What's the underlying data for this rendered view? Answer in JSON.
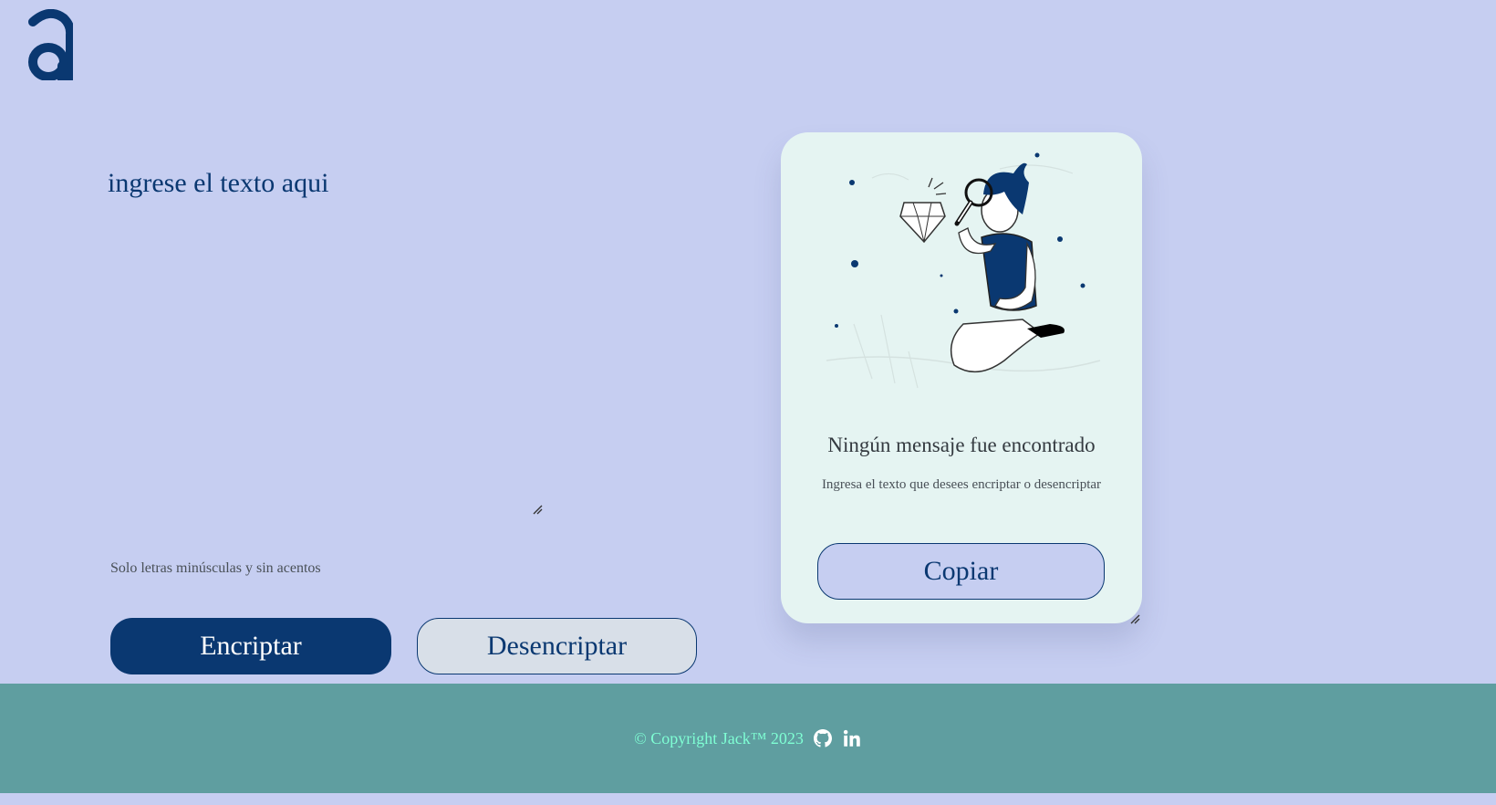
{
  "logo": {
    "text": "a"
  },
  "input": {
    "placeholder": "ingrese el texto aqui",
    "value": ""
  },
  "hint": {
    "icon": "info-icon",
    "text": "Solo letras minúsculas y sin acentos"
  },
  "buttons": {
    "encrypt_label": "Encriptar",
    "decrypt_label": "Desencriptar"
  },
  "output_card": {
    "illustration": "person-with-magnifier-and-diamond",
    "title": "Ningún mensaje fue encontrado",
    "subtitle": "Ingresa el texto que desees encriptar o desencriptar",
    "copy_label": "Copiar"
  },
  "footer": {
    "copyright": "© Copyright Jack™ 2023",
    "icons": [
      "github-icon",
      "linkedin-icon"
    ]
  },
  "colors": {
    "background": "#c6cef1",
    "primary": "#0a3871",
    "card": "#e5f4f2",
    "footer": "#5f9ea0",
    "footer_text": "#7fffd4"
  }
}
